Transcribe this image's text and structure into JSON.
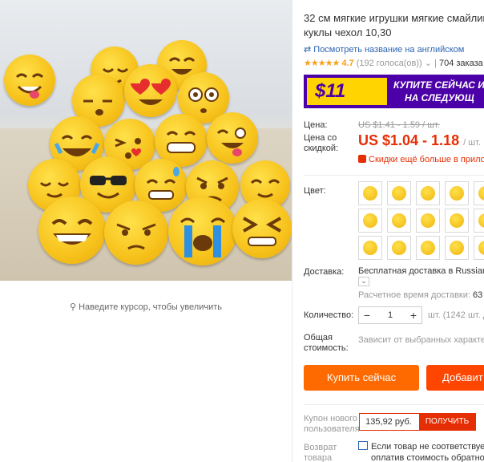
{
  "gallery": {
    "zoom_hint": "Наведите курсор, чтобы увеличить"
  },
  "product": {
    "title_line1": "32 см мягкие игрушки мягкие смайлики",
    "title_line2": "куклы чехол 10,30",
    "translate_link": "Посмотреть название на английском",
    "rating_value": "4.7",
    "votes": "(192 голоса(ов))",
    "orders": "704 заказа"
  },
  "banner": {
    "price": "$11",
    "promo_line1": "КУПИТЕ СЕЙЧАС И",
    "promo_line2": "НА СЛЕДУЮЩ"
  },
  "pricing": {
    "price_label": "Цена:",
    "old_price": "US $1.41 - 1.59 / шт.",
    "discount_label_line1": "Цена со",
    "discount_label_line2": "скидкой:",
    "new_price": "US $1.04 - 1.18",
    "unit": "/ шт.",
    "discount_note": "Скидки ещё больше в приложе"
  },
  "color": {
    "label": "Цвет:"
  },
  "shipping": {
    "label": "Доставка:",
    "value": "Бесплатная доставка в Russian F",
    "time_label": "Расчетное время доставки:",
    "time_value": "63 дн"
  },
  "quantity": {
    "label": "Количество:",
    "minus": "−",
    "value": "1",
    "plus": "+",
    "note": "шт. (1242 шт. д"
  },
  "total": {
    "label_line1": "Общая",
    "label_line2": "стоимость:",
    "value": "Зависит от выбранных характери"
  },
  "actions": {
    "buy_now": "Купить сейчас",
    "add_to_cart": "Добавит"
  },
  "coupon": {
    "label_line1": "Купон нового",
    "label_line2": "пользователя",
    "amount": "135,92 руб.",
    "button": "ПОЛУЧИТЬ"
  },
  "returns": {
    "label_line1": "Возврат",
    "label_line2": "товара",
    "line1": "Если товар не соответствует ор",
    "line2": "оплатив стоимость обратной"
  }
}
